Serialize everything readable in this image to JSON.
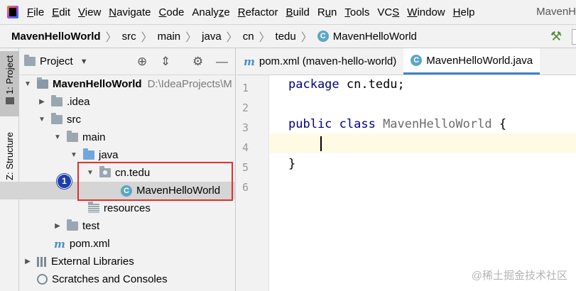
{
  "menubar": {
    "items": [
      {
        "pre": "",
        "u": "F",
        "post": "ile"
      },
      {
        "pre": "",
        "u": "E",
        "post": "dit"
      },
      {
        "pre": "",
        "u": "V",
        "post": "iew"
      },
      {
        "pre": "",
        "u": "N",
        "post": "avigate"
      },
      {
        "pre": "",
        "u": "C",
        "post": "ode"
      },
      {
        "pre": "Analy",
        "u": "z",
        "post": "e"
      },
      {
        "pre": "",
        "u": "R",
        "post": "efactor"
      },
      {
        "pre": "",
        "u": "B",
        "post": "uild"
      },
      {
        "pre": "R",
        "u": "u",
        "post": "n"
      },
      {
        "pre": "",
        "u": "T",
        "post": "ools"
      },
      {
        "pre": "VC",
        "u": "S",
        "post": ""
      },
      {
        "pre": "",
        "u": "W",
        "post": "indow"
      },
      {
        "pre": "",
        "u": "H",
        "post": "elp"
      }
    ],
    "window_title": "MavenH"
  },
  "breadcrumbs": [
    "MavenHelloWorld",
    "src",
    "main",
    "java",
    "cn",
    "tedu",
    "MavenHelloWorld"
  ],
  "toolstrip": {
    "project_tab": "1: Project",
    "structure_tab": "Z: Structure"
  },
  "project_panel": {
    "title": "Project",
    "tree": [
      {
        "label": "MavenHelloWorld",
        "path": "D:\\IdeaProjects\\M"
      },
      {
        "label": ".idea"
      },
      {
        "label": "src"
      },
      {
        "label": "main"
      },
      {
        "label": "java"
      },
      {
        "label": "cn.tedu"
      },
      {
        "label": "MavenHelloWorld"
      },
      {
        "label": "resources"
      },
      {
        "label": "test"
      },
      {
        "label": "pom.xml"
      },
      {
        "label": "External Libraries"
      },
      {
        "label": "Scratches and Consoles"
      }
    ]
  },
  "annotation": {
    "step": "1"
  },
  "editor": {
    "tabs": [
      {
        "label": "pom.xml (maven-hello-world)"
      },
      {
        "label": "MavenHelloWorld.java"
      }
    ],
    "line_numbers": [
      "1",
      "2",
      "3",
      "4",
      "5",
      "6"
    ],
    "code": {
      "line1_kw": "package",
      "line1_rest": " cn.tedu;",
      "line3_kw": "public class",
      "line3_cls": " MavenHelloWorld",
      "line3_rest": " {",
      "line5": "}"
    }
  },
  "watermark": "@稀土掘金技术社区"
}
